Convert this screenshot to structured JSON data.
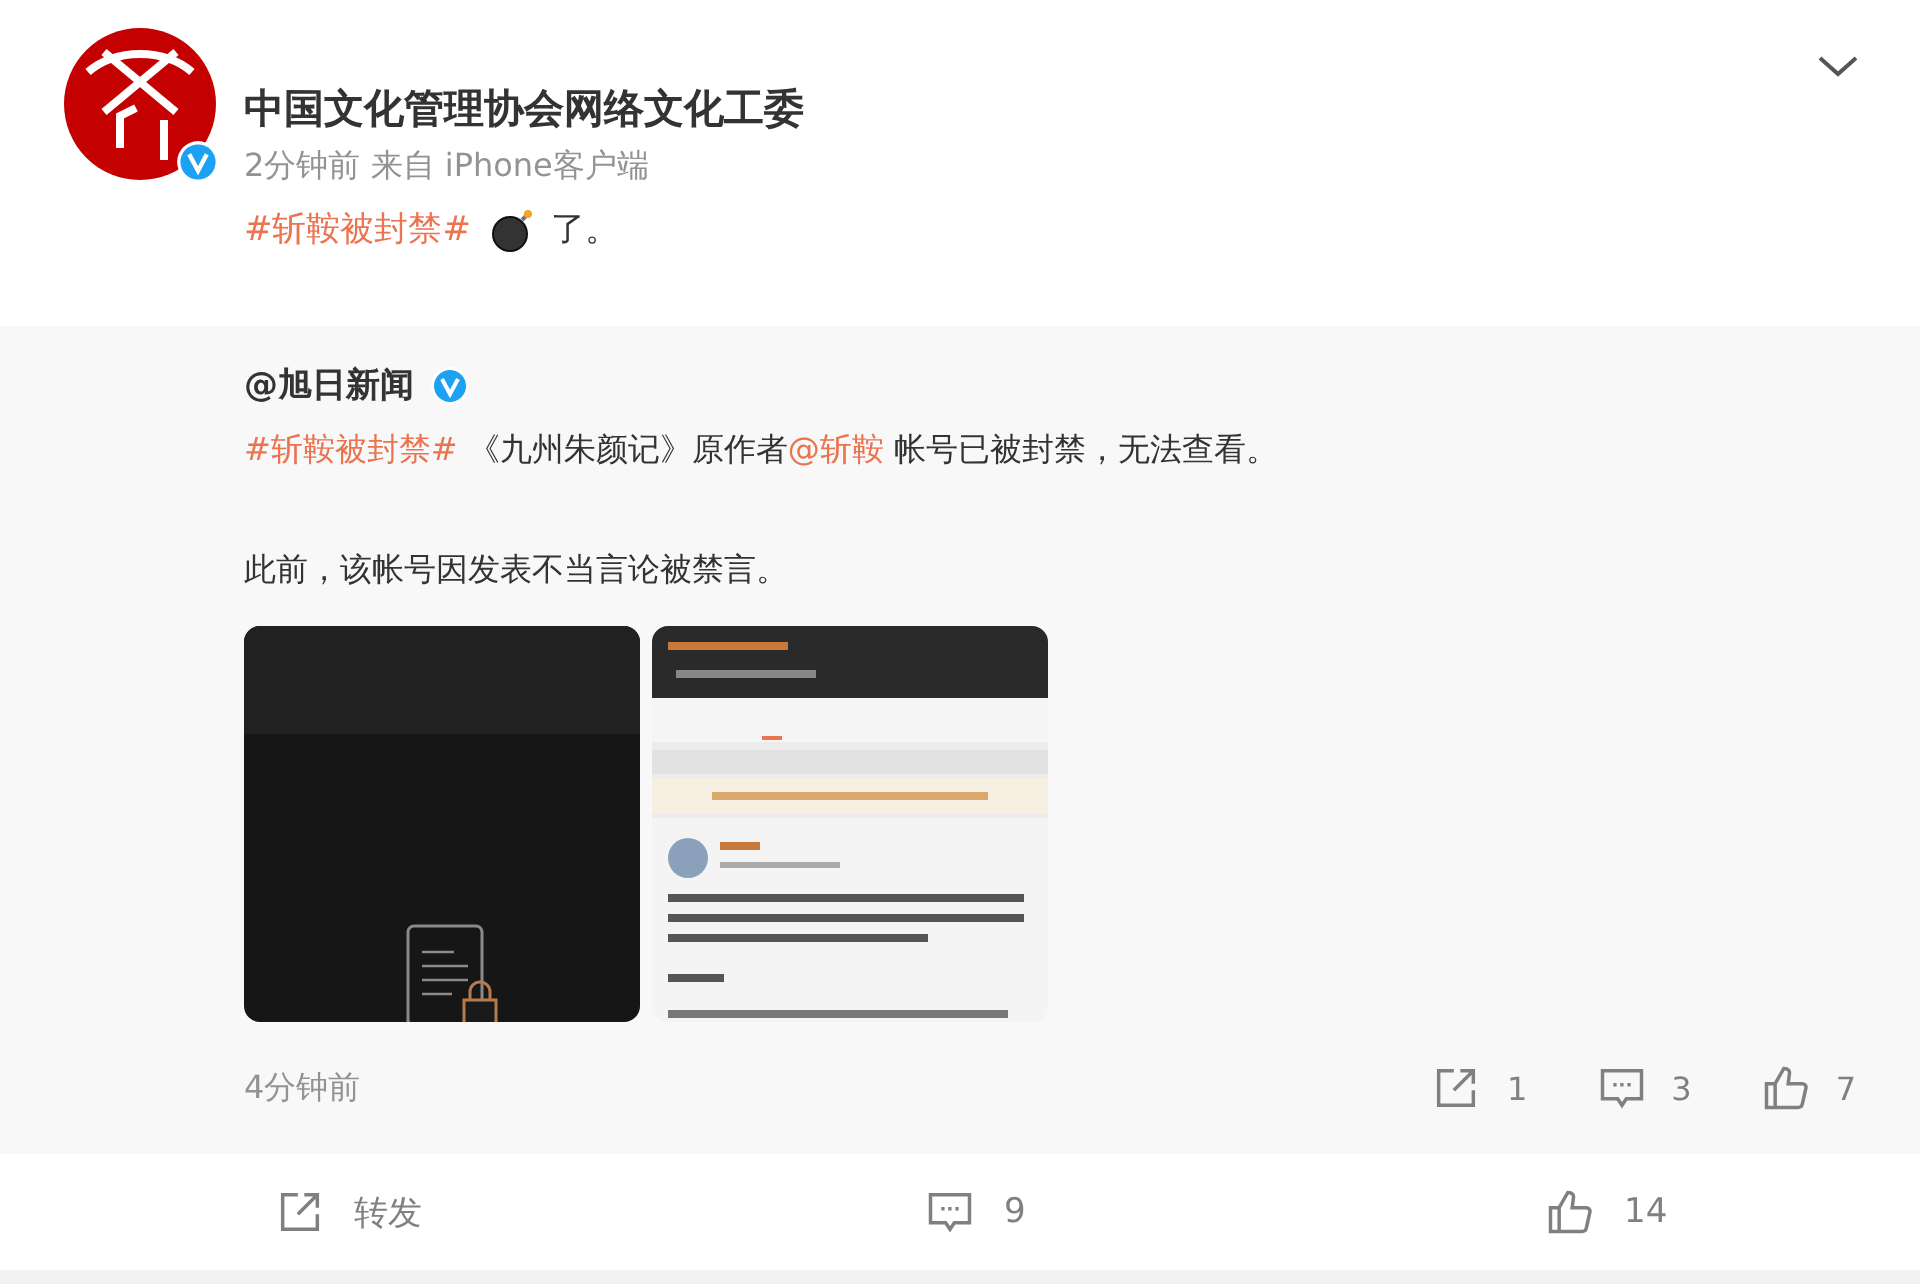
{
  "post": {
    "author": "中国文化管理协会网络文化工委",
    "verified": true,
    "time": "2分钟前",
    "source": "来自 iPhone客户端",
    "content": [
      {
        "kind": "topic",
        "text": "#斩鞍被封禁#"
      },
      {
        "kind": "emoji"
      },
      {
        "kind": "text",
        "text": "了。"
      }
    ]
  },
  "repost": {
    "author": "@旭日新闻",
    "verified": true,
    "paragraphs": [
      [
        {
          "kind": "topic",
          "text": "#斩鞍被封禁#"
        },
        {
          "kind": "text",
          "text": " 《九州朱颜记》原作者"
        },
        {
          "kind": "mention",
          "text": "@斩鞍"
        },
        {
          "kind": "text",
          "text": " 帐号已被封禁，无法查看。"
        }
      ],
      [
        {
          "kind": "text",
          "text": "此前，该帐号因发表不当言论被禁言。"
        }
      ]
    ],
    "images": [
      {
        "kind": "dark"
      },
      {
        "kind": "light"
      }
    ],
    "time": "4分钟前",
    "reposts": "1",
    "comments": "3",
    "likes": "7"
  },
  "actions": {
    "repost_label": "转发",
    "comments": "9",
    "likes": "14"
  }
}
